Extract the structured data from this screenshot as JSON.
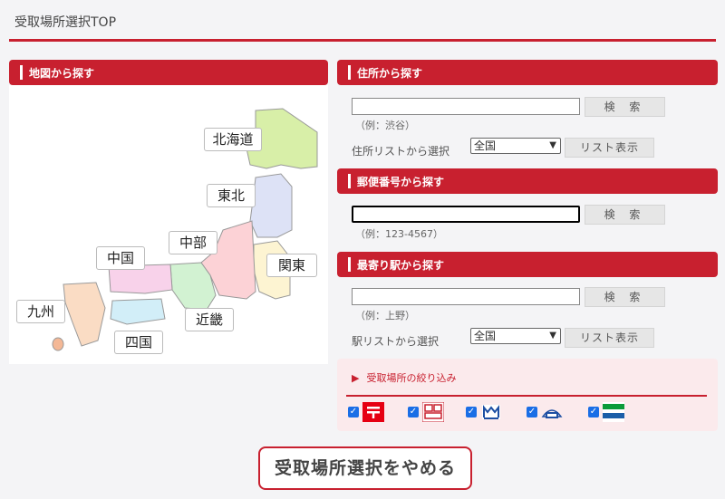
{
  "page": {
    "title": "受取場所選択TOP"
  },
  "map_section": {
    "header": "地図から探す",
    "regions": {
      "hokkaido": "北海道",
      "tohoku": "東北",
      "chubu": "中部",
      "kanto": "関東",
      "chugoku": "中国",
      "kinki": "近畿",
      "kyushu": "九州",
      "shikoku": "四国"
    }
  },
  "address_section": {
    "header": "住所から探す",
    "input_value": "",
    "search_label": "検 索",
    "example": "（例：渋谷）",
    "list_label": "住所リストから選択",
    "select_value": "全国",
    "list_button": "リスト表示"
  },
  "postal_section": {
    "header": "郵便番号から探す",
    "input_value": "",
    "search_label": "検 索",
    "example": "（例：123-4567）"
  },
  "station_section": {
    "header": "最寄り駅から探す",
    "input_value": "",
    "search_label": "検 索",
    "example": "（例：上野）",
    "list_label": "駅リストから選択",
    "select_value": "全国",
    "list_button": "リスト表示"
  },
  "filter": {
    "title": "受取場所の絞り込み",
    "arrow": "▶",
    "options": [
      {
        "name": "post-office",
        "checked": true
      },
      {
        "name": "lawson",
        "checked": true
      },
      {
        "name": "ministop",
        "checked": true
      },
      {
        "name": "pudo-locker",
        "checked": true
      },
      {
        "name": "familymart",
        "checked": true
      }
    ]
  },
  "cancel_button": "受取場所選択をやめる",
  "colors": {
    "accent": "#c8202f",
    "filter_bg": "#fbeaec",
    "checkbox": "#1a6ee6"
  }
}
